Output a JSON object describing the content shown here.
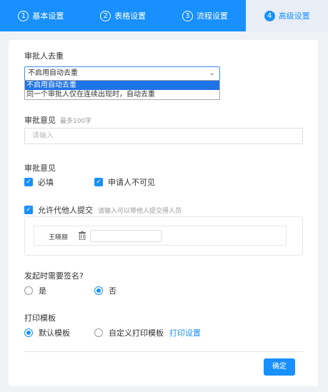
{
  "tabs": [
    {
      "num": "1",
      "label": "基本设置"
    },
    {
      "num": "2",
      "label": "表格设置"
    },
    {
      "num": "3",
      "label": "流程设置"
    },
    {
      "num": "4",
      "label": "高级设置"
    }
  ],
  "dedupe": {
    "label": "审批人去重",
    "selected": "不启用自动去重",
    "options": [
      "不启用自动去重",
      "同一个审批人仅在连续出现时，自动去重"
    ]
  },
  "opinion": {
    "label": "审批意见",
    "hint": "最多100字",
    "placeholder": "请输入"
  },
  "opinion2": {
    "label": "审批意见",
    "required": "必填",
    "applicant_hidden": "申请人不可见"
  },
  "agent": {
    "label": "允许代他人提交",
    "hint": "请输入可以带他人提交得人员",
    "name": "王晓丽"
  },
  "signature": {
    "label": "发起时需要签名?",
    "yes": "是",
    "no": "否",
    "value": "no"
  },
  "print": {
    "label": "打印模板",
    "default": "默认模板",
    "custom": "自定义打印模板",
    "settings": "打印设置",
    "value": "default"
  },
  "confirm": "确定",
  "colors": {
    "primary": "#1890ff"
  }
}
